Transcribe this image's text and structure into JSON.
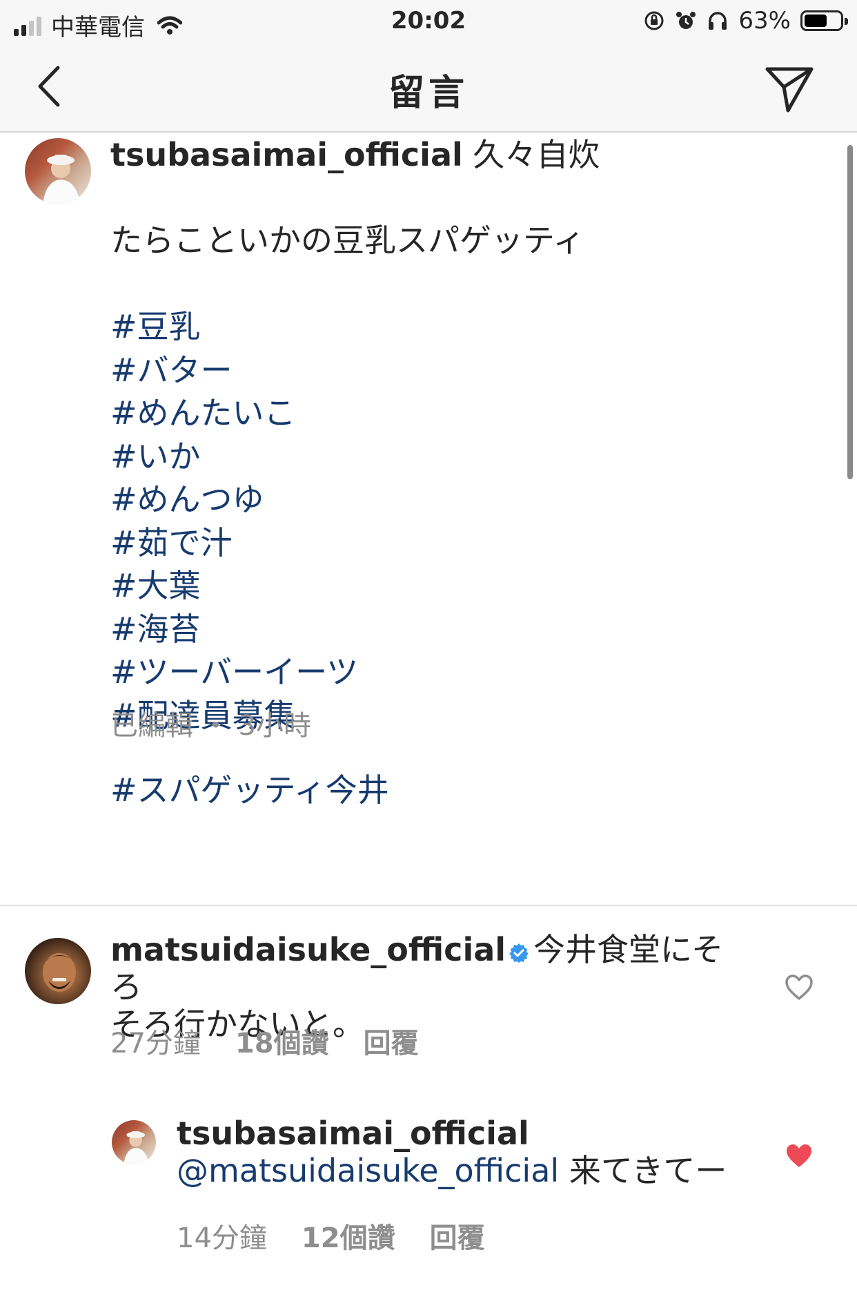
{
  "status_bar": {
    "carrier": "中華電信",
    "time": "20:02",
    "battery_percent_label": "63%",
    "battery_level": 0.63,
    "signal_bars_active": 2,
    "signal_bars_total": 4,
    "icons": [
      "wifi-icon",
      "orientation-lock-icon",
      "alarm-icon",
      "headphones-icon",
      "battery-icon"
    ]
  },
  "nav": {
    "title": "留言",
    "back_icon": "chevron-left-icon",
    "send_icon": "paper-plane-icon"
  },
  "caption": {
    "username": "tsubasaimai_official",
    "first_line": "久々自炊",
    "second_line": "たらこといかの豆乳スパゲッティ",
    "hashtags": [
      "#豆乳",
      "#バター",
      "#めんたいこ",
      "#いか",
      "#めんつゆ",
      "#茹で汁",
      "#大葉",
      "#海苔",
      "#ツーバーイーツ",
      "#配達員募集"
    ],
    "final_hashtag": "#スパゲッティ今井",
    "edited_label": "已編輯",
    "separator": "・",
    "time_ago": "3小時"
  },
  "comments": [
    {
      "username": "matsuidaisuke_official",
      "verified": true,
      "text_line1": "今井食堂にそろ",
      "text_line2": "そろ行かないと。",
      "time_ago": "27分鐘",
      "likes": "18個讚",
      "reply_label": "回覆",
      "liked": false
    },
    {
      "username": "tsubasaimai_official",
      "mention": "@matsuidaisuke_official",
      "text": "来てきてー",
      "time_ago": "14分鐘",
      "likes": "12個讚",
      "reply_label": "回覆",
      "liked": true
    }
  ],
  "colors": {
    "hashtag": "#173b6f",
    "meta_gray": "#8e8e8e",
    "heart_red": "#ed4956",
    "verified_blue": "#3897f0"
  }
}
